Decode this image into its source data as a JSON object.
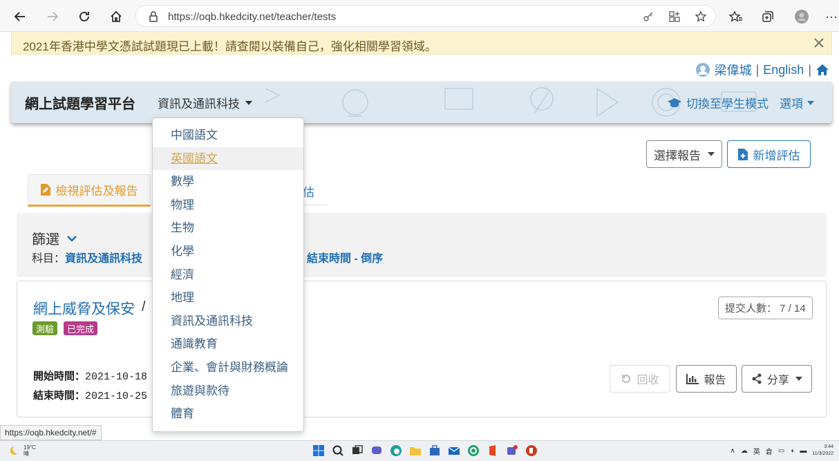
{
  "browser": {
    "url": "https://oqb.hkedcity.net/teacher/tests",
    "menu_glyph": "···"
  },
  "banner": {
    "text": "2021年香港中學文憑試試題現已上載！請查閱以裝備自己，強化相關學習領域。",
    "close_glyph": "✕"
  },
  "user": {
    "name": "梁偉城",
    "sep": "|",
    "language": "English"
  },
  "header": {
    "title": "網上試題學習平台",
    "subject": "資訊及通訊科技",
    "student_mode": "切換至學生模式",
    "options": "選項"
  },
  "actions": {
    "select_report": "選擇報告",
    "new_eval": "新增評估"
  },
  "tabs": {
    "view": "檢視評估及報告",
    "other": "估"
  },
  "filter": {
    "title": "篩選",
    "subject_label": "科目：",
    "subject_value": "資訊及通訊科技",
    "sort": "結束時間 - 倒序"
  },
  "card": {
    "title": "網上威脅及保安",
    "slash": "/",
    "type_badge": "測驗",
    "status_badge": "已完成",
    "submit_count": "提交人數： 7 / 14",
    "start_label": "開始時間：",
    "start_value": "2021-10-18",
    "end_label": "結束時間：",
    "end_value": "2021-10-25",
    "recall": "回收",
    "report": "報告",
    "share": "分享"
  },
  "dropdown": {
    "items": [
      "中國語文",
      "英國語文",
      "數學",
      "物理",
      "生物",
      "化學",
      "經濟",
      "地理",
      "資訊及通訊科技",
      "通識教育",
      "企業、會計與財務概論",
      "旅遊與款待",
      "體育"
    ],
    "active_index": 1
  },
  "status_link": "https://oqb.hkedcity.net/#",
  "taskbar": {
    "temp": "19°C",
    "weather": "晴",
    "ime": "英",
    "ime2": "倉",
    "time": "3:44",
    "date": "11/3/2022"
  }
}
